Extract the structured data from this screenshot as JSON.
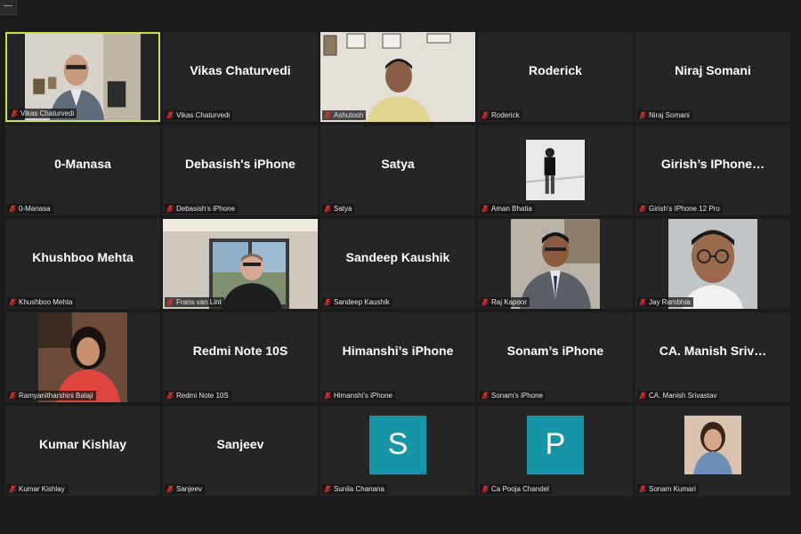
{
  "window": {
    "menu_button": "—"
  },
  "participants": [
    {
      "display": "",
      "label": "Vikas Chaturvedi",
      "type": "video",
      "scene": "office-man-glasses",
      "active": true
    },
    {
      "display": "Vikas Chaturvedi",
      "label": "Vikas Chaturvedi",
      "type": "name"
    },
    {
      "display": "",
      "label": "Ashutosh",
      "type": "video",
      "scene": "office-man-wall"
    },
    {
      "display": "Roderick",
      "label": "Roderick",
      "type": "name"
    },
    {
      "display": "Niraj Somani",
      "label": "Niraj Somani",
      "type": "name"
    },
    {
      "display": "0-Manasa",
      "label": "0-Manasa",
      "type": "name"
    },
    {
      "display": "Debasish's iPhone",
      "label": "Debasish's iPhone",
      "type": "name"
    },
    {
      "display": "Satya",
      "label": "Satya",
      "type": "name"
    },
    {
      "display": "",
      "label": "Aman Bhatia",
      "type": "photo",
      "scene": "bw-photo"
    },
    {
      "display": "Girish’s IPhone…",
      "label": "Girish's IPhone 12 Pro",
      "type": "name"
    },
    {
      "display": "Khushboo Mehta",
      "label": "Khushboo Mehta",
      "type": "name"
    },
    {
      "display": "",
      "label": "Frans van Lint",
      "type": "video",
      "scene": "window-man"
    },
    {
      "display": "Sandeep Kaushik",
      "label": "Sandeep Kaushik",
      "type": "name"
    },
    {
      "display": "",
      "label": "Raj Kapoor",
      "type": "photo",
      "scene": "suit-man"
    },
    {
      "display": "",
      "label": "Jay Rambhia",
      "type": "photo",
      "scene": "portrait-glasses"
    },
    {
      "display": "",
      "label": "Ramyanitharshini Balaji",
      "type": "photo",
      "scene": "woman-red"
    },
    {
      "display": "Redmi Note 10S",
      "label": "Redmi Note 10S",
      "type": "name"
    },
    {
      "display": "Himanshi’s iPhone",
      "label": "Himanshi's iPhone",
      "type": "name"
    },
    {
      "display": "Sonam’s iPhone",
      "label": "Sonam's iPhone",
      "type": "name"
    },
    {
      "display": "CA. Manish Sriv…",
      "label": "CA. Manish Srivastav",
      "type": "name"
    },
    {
      "display": "Kumar Kishlay",
      "label": "Kumar Kishlay",
      "type": "name"
    },
    {
      "display": "Sanjeev",
      "label": "Sanjeev",
      "type": "name"
    },
    {
      "display": "S",
      "label": "Sunila Chanana",
      "type": "letter"
    },
    {
      "display": "P",
      "label": "Ca Pooja Chandel",
      "type": "letter"
    },
    {
      "display": "",
      "label": "Sonam Kumari",
      "type": "photo-small",
      "scene": "woman-portrait"
    }
  ],
  "colors": {
    "background": "#1b1b1b",
    "tile": "#252525",
    "active_border": "#c9e247",
    "avatar": "#1795a7",
    "mic_muted": "#e0302b"
  },
  "icons": {
    "mic": "muted-mic-icon"
  }
}
